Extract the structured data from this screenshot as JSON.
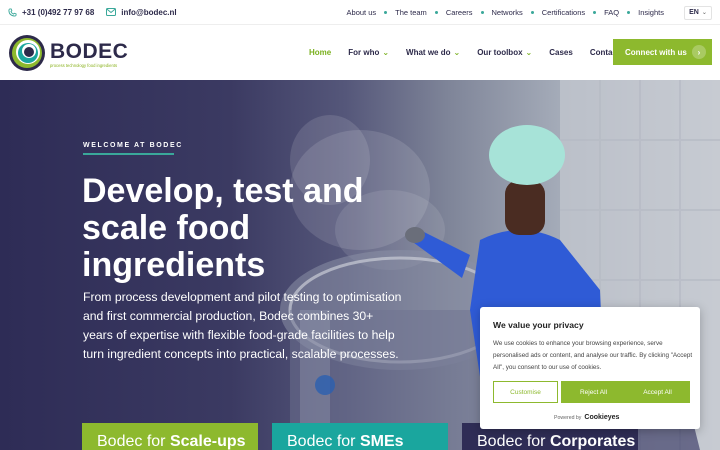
{
  "topbar": {
    "phone": "+31 (0)492 77 97 68",
    "email": "info@bodec.nl",
    "links": [
      "About us",
      "The team",
      "Careers",
      "Networks",
      "Certifications",
      "FAQ",
      "Insights"
    ],
    "language": "EN"
  },
  "brand": {
    "name": "BODEC",
    "tagline": "process technology food ingredients",
    "colors": {
      "navy": "#2d2a4a",
      "green": "#8db92e",
      "teal": "#1aa69e"
    }
  },
  "nav": {
    "items": [
      {
        "label": "Home",
        "active": true,
        "dropdown": false
      },
      {
        "label": "For who",
        "dropdown": true
      },
      {
        "label": "What we do",
        "dropdown": true
      },
      {
        "label": "Our toolbox",
        "dropdown": true
      },
      {
        "label": "Cases",
        "dropdown": false
      },
      {
        "label": "Contact",
        "dropdown": false
      }
    ],
    "cta": "Connect with us"
  },
  "hero": {
    "kicker": "WELCOME AT BODEC",
    "title": "Develop, test and scale food ingredients",
    "lead": "From process development and pilot testing to optimisation and first commercial production, Bodec combines 30+ years of expertise with flexible food-grade facilities to help turn ingredient concepts into practical, scalable processes."
  },
  "cards": [
    {
      "prefix": "Bodec for ",
      "strong": "Scale-ups"
    },
    {
      "prefix": "Bodec for ",
      "strong": "SMEs"
    },
    {
      "prefix": "Bodec for ",
      "strong": "Corporates"
    }
  ],
  "cookie": {
    "title": "We value your privacy",
    "text": "We use cookies to enhance your browsing experience, serve personalised ads or content, and analyse our traffic. By clicking \"Accept All\", you consent to our use of cookies.",
    "buttons": {
      "customise": "Customise",
      "reject": "Reject All",
      "accept": "Accept All"
    },
    "powered_prefix": "Powered by",
    "powered_brand": "Cookieyes"
  }
}
